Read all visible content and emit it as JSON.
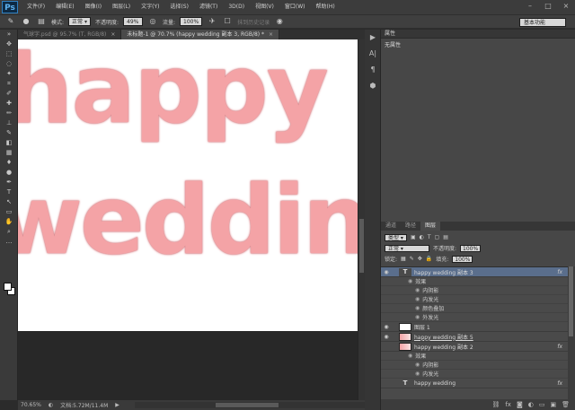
{
  "app": {
    "logo": "Ps"
  },
  "menu": [
    "文件(F)",
    "编辑(E)",
    "图像(I)",
    "图层(L)",
    "文字(Y)",
    "选择(S)",
    "滤镜(T)",
    "3D(D)",
    "视图(V)",
    "窗口(W)",
    "帮助(H)"
  ],
  "options": {
    "mode_label": "模式:",
    "mode_value": "正常",
    "opacity_label": "不透明度:",
    "opacity_value": "49%",
    "flow_label": "流量:",
    "flow_value": "100%",
    "history_label": "抹到历史记录",
    "workspace": "基本功能"
  },
  "tabs": [
    {
      "label": "气球字.psd @ 95.7% (T, RGB/8)",
      "close": "×"
    },
    {
      "label": "未标题-1 @ 70.7% (happy wedding 副本 3, RGB/8) *",
      "close": "×"
    }
  ],
  "canvas": {
    "line1": "happy",
    "line2": "wedding",
    "text_color": "#f4a3a6"
  },
  "status": {
    "zoom": "70.65%",
    "doc_info": "文档:5.72M/11.4M"
  },
  "properties": {
    "title": "属性",
    "empty": "无属性"
  },
  "layers_panel": {
    "tabs": [
      "通道",
      "路径",
      "图层"
    ],
    "kind_label": "类型",
    "blend_mode": "正常",
    "opacity_label": "不透明度:",
    "opacity_value": "100%",
    "lock_label": "锁定:",
    "fill_label": "填充:",
    "fill_value": "100%",
    "layers": [
      {
        "name": "happy wedding 副本 3",
        "fx": "fx",
        "selected": true
      },
      {
        "name": "效果",
        "level": 1
      },
      {
        "name": "内阴影",
        "level": 2
      },
      {
        "name": "内发光",
        "level": 2
      },
      {
        "name": "颜色叠加",
        "level": 2
      },
      {
        "name": "外发光",
        "level": 2
      },
      {
        "name": "图层 1"
      },
      {
        "name": "happy wedding 副本 5"
      },
      {
        "name": "happy wedding 副本 2",
        "fx": "fx"
      },
      {
        "name": "效果",
        "level": 1
      },
      {
        "name": "内阴影",
        "level": 2
      },
      {
        "name": "内发光",
        "level": 2
      },
      {
        "name": "happy wedding",
        "fx": "fx"
      }
    ]
  }
}
